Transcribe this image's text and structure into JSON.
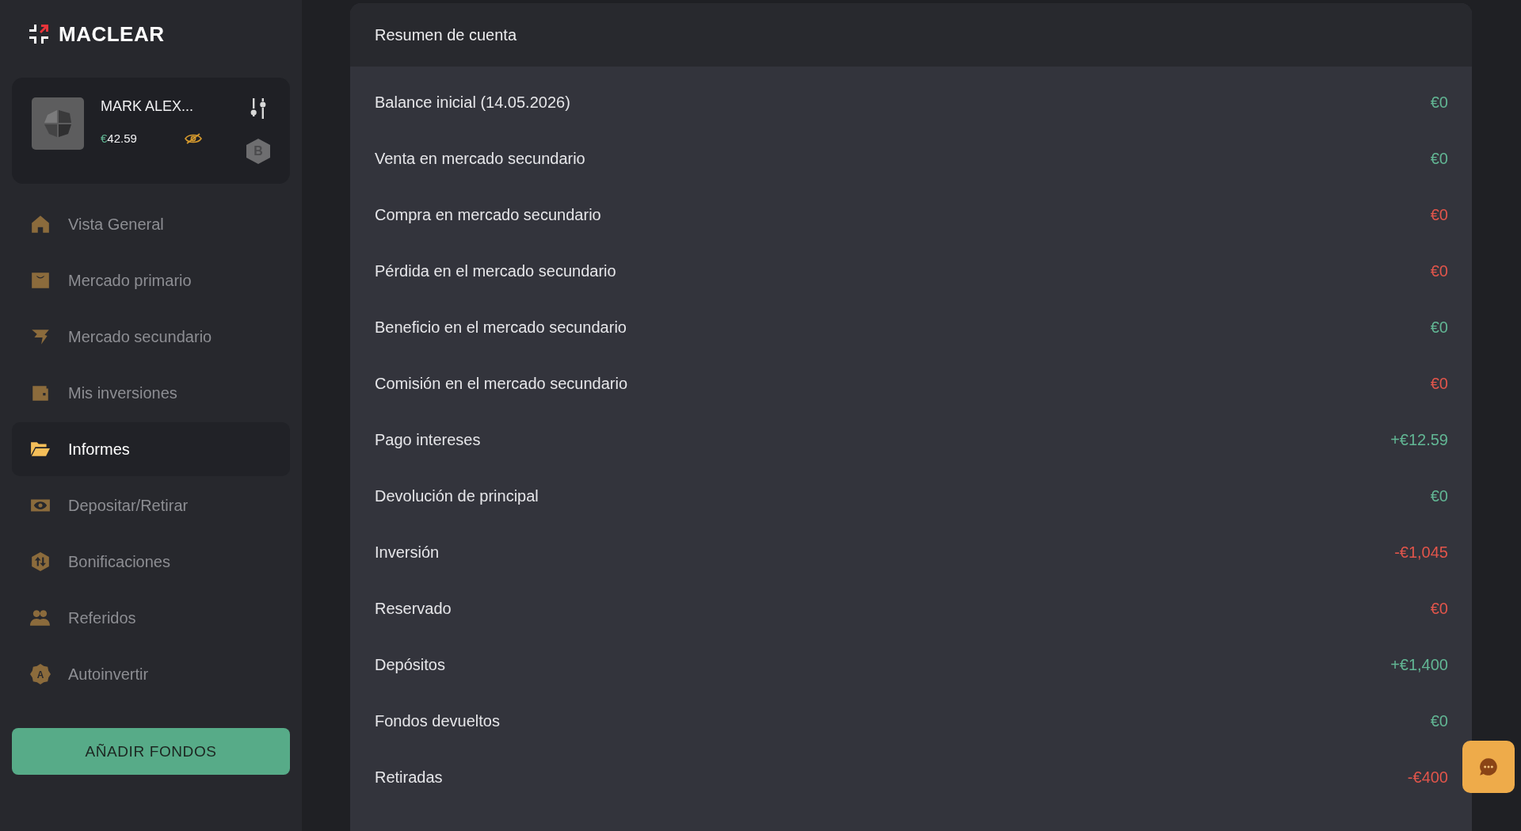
{
  "brand": {
    "name": "MACLEAR"
  },
  "profile": {
    "name": "MARK ALEX...",
    "balance": {
      "currency": "€",
      "amount": "42.59"
    },
    "tier_badge": "B"
  },
  "sidebar": {
    "items": [
      {
        "label": "Vista General",
        "selected": false
      },
      {
        "label": "Mercado primario",
        "selected": false
      },
      {
        "label": "Mercado secundario",
        "selected": false
      },
      {
        "label": "Mis inversiones",
        "selected": false
      },
      {
        "label": "Informes",
        "selected": true
      },
      {
        "label": "Depositar/Retirar",
        "selected": false
      },
      {
        "label": "Bonificaciones",
        "selected": false
      },
      {
        "label": "Referidos",
        "selected": false
      },
      {
        "label": "Autoinvertir",
        "selected": false,
        "icon_text": "A"
      }
    ],
    "add_funds_button": "AÑADIR FONDOS"
  },
  "summary": {
    "title": "Resumen de cuenta",
    "rows": [
      {
        "label": "Balance inicial (14.05.2026)",
        "value": "€0",
        "color": "#62b694"
      },
      {
        "label": "Venta en mercado secundario",
        "value": "€0",
        "color": "#62b694"
      },
      {
        "label": "Compra en mercado secundario",
        "value": "€0",
        "color": "#e2554b"
      },
      {
        "label": "Pérdida en el mercado secundario",
        "value": "€0",
        "color": "#e2554b"
      },
      {
        "label": "Beneficio en el mercado secundario",
        "value": "€0",
        "color": "#62b694"
      },
      {
        "label": "Comisión en el mercado secundario",
        "value": "€0",
        "color": "#e2554b"
      },
      {
        "label": "Pago intereses",
        "value": "+€12.59",
        "color": "#62b694"
      },
      {
        "label": "Devolución de principal",
        "value": "€0",
        "color": "#62b694"
      },
      {
        "label": "Inversión",
        "value": "-€1,045",
        "color": "#e2554b"
      },
      {
        "label": "Reservado",
        "value": "€0",
        "color": "#e2554b"
      },
      {
        "label": "Depósitos",
        "value": "+€1,400",
        "color": "#62b694"
      },
      {
        "label": "Fondos devueltos",
        "value": "€0",
        "color": "#62b694"
      },
      {
        "label": "Retiradas",
        "value": "-€400",
        "color": "#e2554b"
      }
    ]
  }
}
